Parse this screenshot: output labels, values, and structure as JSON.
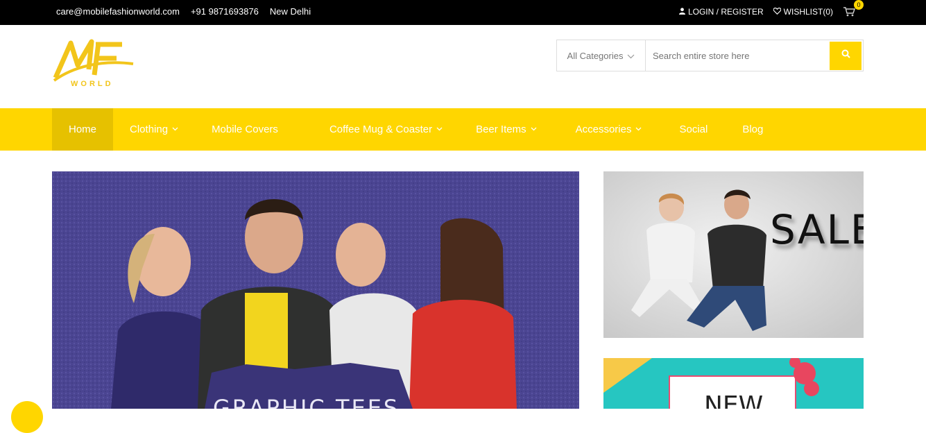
{
  "topbar": {
    "email": "care@mobilefashionworld.com",
    "phone": "+91 9871693876",
    "city": "New Delhi",
    "login": "LOGIN / REGISTER",
    "wishlist": "WISHLIST(0)",
    "cart_count": "0"
  },
  "logo": {
    "letters": "MF",
    "word": "WORLD"
  },
  "search": {
    "category": "All Categories",
    "placeholder": "Search entire store here"
  },
  "nav": {
    "items": [
      {
        "label": "Home",
        "active": true
      },
      {
        "label": "Clothing",
        "dropdown": true
      },
      {
        "label": "Mobile Covers"
      },
      {
        "label": "Coffee Mug & Coaster",
        "dropdown": true
      },
      {
        "label": "Beer Items",
        "dropdown": true
      },
      {
        "label": "Accessories",
        "dropdown": true
      },
      {
        "label": "Social"
      },
      {
        "label": "Blog"
      }
    ]
  },
  "hero": {
    "caption": "GRAPHIC TEES"
  },
  "promo1": {
    "text": "SALE"
  },
  "promo2": {
    "text": "NEW"
  },
  "colors": {
    "accent": "#ffd600",
    "topbar": "#000000",
    "hero_bg": "#4b4592"
  }
}
